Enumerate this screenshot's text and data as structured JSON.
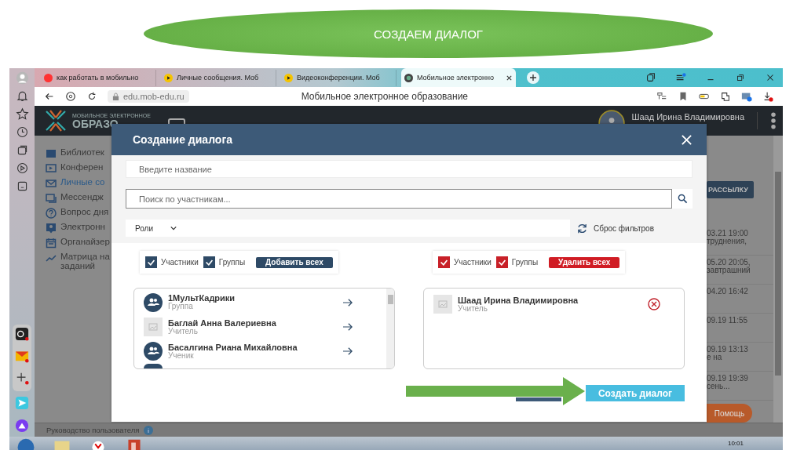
{
  "slide_title": "СОЗДАЕМ ДИАЛОГ",
  "browser": {
    "tabs": [
      {
        "label": "как работать в мобильно",
        "selected": false,
        "kind": "yandex"
      },
      {
        "label": "Личные сообщения. Моб",
        "selected": false,
        "kind": "play"
      },
      {
        "label": "Видеоконференции. Моб",
        "selected": false,
        "kind": "play"
      },
      {
        "label": "Мобильное электронно",
        "selected": true,
        "kind": "site"
      }
    ],
    "url": "edu.mob-edu.ru",
    "page_title": "Мобильное электронное образование"
  },
  "app": {
    "logo_small": "МОБИЛЬНОЕ ЭЛЕКТРОННОЕ",
    "logo_big": "ОБРАЗО",
    "user": "Шаад Ирина Владимировна",
    "nav": [
      {
        "label": "Библиотек",
        "selected": false,
        "kind": "book"
      },
      {
        "label": "Конферен",
        "selected": false,
        "kind": "screen"
      },
      {
        "label": "Личные со",
        "selected": true,
        "kind": "mail"
      },
      {
        "label": "Мессендж",
        "selected": false,
        "kind": "chat"
      },
      {
        "label": "Вопрос дня",
        "selected": false,
        "kind": "question"
      },
      {
        "label": "Электронн",
        "selected": false,
        "kind": "person"
      },
      {
        "label": "Органайзер",
        "selected": false,
        "kind": "calendar"
      },
      {
        "label": "Матрица на заданий",
        "selected": false,
        "kind": "chart"
      }
    ],
    "mailing_button": "РАССЫЛКУ",
    "messages": [
      {
        "time": "03.21 19:00",
        "snippet": "труднения,"
      },
      {
        "time": "05.20 20:05,",
        "snippet": "завтрашний"
      },
      {
        "time": "04.20 16:42"
      },
      {
        "time": "09.19 11:55"
      },
      {
        "time": "09.19 13:13",
        "snippet": "е на"
      },
      {
        "time": "09.19 19:39",
        "snippet": "сень..."
      }
    ],
    "help_button": "Помощь",
    "guide": "Руководство пользователя"
  },
  "modal": {
    "title": "Создание диалога",
    "name_placeholder": "Введите название",
    "search_placeholder": "Поиск по участникам...",
    "roles": "Роли",
    "reset": "Сброс фильтров",
    "left_filters": {
      "checks": [
        {
          "label": "Участники",
          "checked": true
        },
        {
          "label": "Группы",
          "checked": true
        }
      ],
      "button": "Добавить всех"
    },
    "right_filters": {
      "checks": [
        {
          "label": "Участники",
          "checked": true
        },
        {
          "label": "Группы",
          "checked": true
        }
      ],
      "button": "Удалить всех"
    },
    "candidates": [
      {
        "name": "1МультКадрики",
        "role": "Группа",
        "kind": "group"
      },
      {
        "name": "Баглай Анна Валериевна",
        "role": "Учитель",
        "kind": "photo"
      },
      {
        "name": "Басалгина Риана Михайловна",
        "role": "Ученик",
        "kind": "group"
      }
    ],
    "members": [
      {
        "name": "Шаад Ирина Владимировна",
        "role": "Учитель",
        "kind": "photo"
      }
    ],
    "create_button": "Создать диалог"
  },
  "taskbar": {
    "clock": "10:01"
  }
}
